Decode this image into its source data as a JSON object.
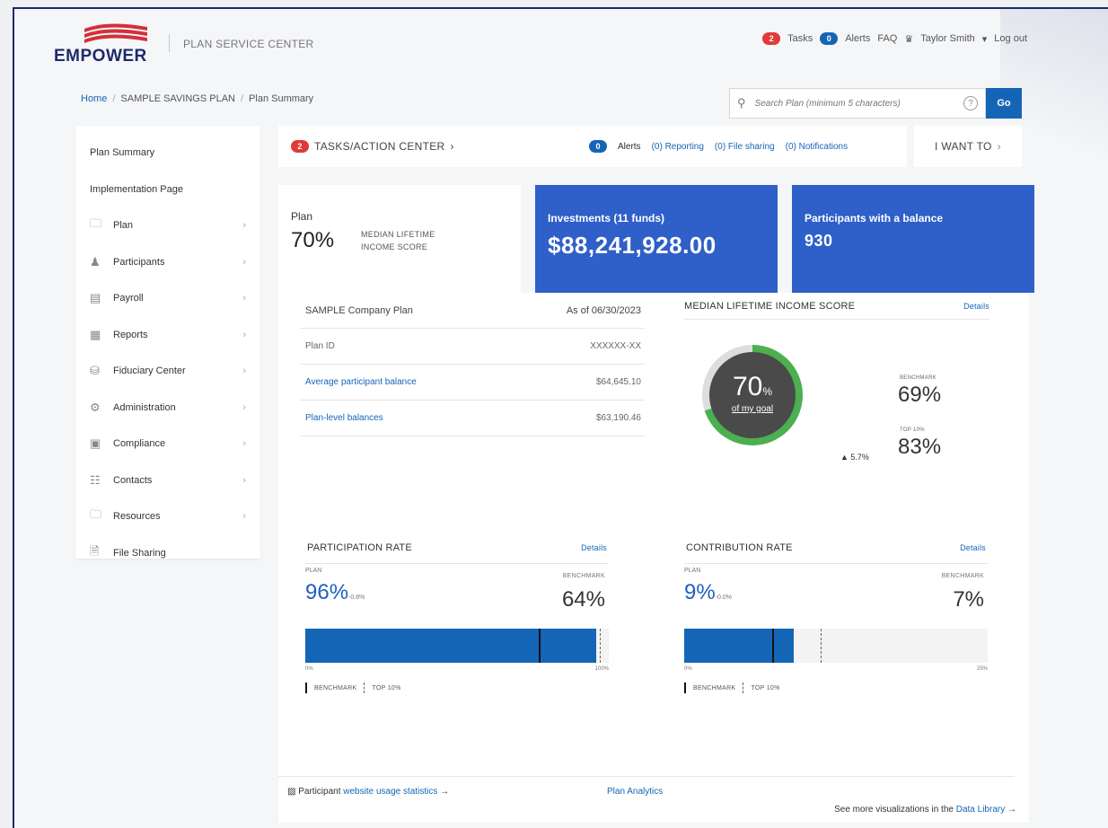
{
  "header": {
    "brand": "EMPOWER",
    "service_title": "PLAN SERVICE CENTER",
    "tasks_count": "2",
    "tasks_label": "Tasks",
    "alerts_count": "0",
    "alerts_label": "Alerts",
    "faq_label": "FAQ",
    "user_name": "Taylor Smith",
    "logout_label": "Log out"
  },
  "breadcrumb": {
    "home": "Home",
    "plan": "SAMPLE SAVINGS PLAN",
    "current": "Plan Summary"
  },
  "search": {
    "placeholder": "Search Plan (minimum 5 characters)",
    "go_label": "Go"
  },
  "sidebar": {
    "items": [
      {
        "label": "Plan Summary"
      },
      {
        "label": "Implementation Page"
      },
      {
        "label": "Plan",
        "icon": "folder-icon"
      },
      {
        "label": "Participants",
        "icon": "people-icon"
      },
      {
        "label": "Payroll",
        "icon": "payroll-icon"
      },
      {
        "label": "Reports",
        "icon": "report-icon"
      },
      {
        "label": "Fiduciary Center",
        "icon": "database-icon"
      },
      {
        "label": "Administration",
        "icon": "gear-icon"
      },
      {
        "label": "Compliance",
        "icon": "compliance-icon"
      },
      {
        "label": "Contacts",
        "icon": "contacts-icon"
      },
      {
        "label": "Resources",
        "icon": "folder-icon"
      },
      {
        "label": "File Sharing",
        "icon": "file-icon"
      }
    ]
  },
  "taskbar": {
    "tasks_count": "2",
    "title": "TASKS/ACTION CENTER",
    "alerts_count": "0",
    "alerts_label": "Alerts",
    "reporting": "(0) Reporting",
    "file_sharing": "(0) File sharing",
    "notifications": "(0) Notifications",
    "i_want_to": "I WANT TO"
  },
  "kpi": {
    "plan_label": "Plan",
    "plan_value": "70%",
    "plan_sub1": "MEDIAN LIFETIME",
    "plan_sub2": "INCOME SCORE",
    "investments_label": "Investments (11 funds)",
    "investments_value": "$88,241,928.00",
    "participants_label": "Participants with a balance",
    "participants_value": "930"
  },
  "plan_info": {
    "name": "SAMPLE Company Plan",
    "as_of": "As of 06/30/2023",
    "rows": [
      {
        "label": "Plan ID",
        "value": "XXXXXX-XX"
      },
      {
        "label": "Average participant balance",
        "value": "$64,645.10"
      },
      {
        "label": "Plan-level balances",
        "value": "$63,190.46"
      }
    ]
  },
  "mlis": {
    "title": "MEDIAN LIFETIME INCOME SCORE",
    "details": "Details",
    "score": "70",
    "score_unit": "%",
    "goal_text": "of my goal",
    "delta": "▲ 5.7%",
    "benchmark_label": "BENCHMARK",
    "benchmark_value": "69%",
    "top10_label": "TOP 10%",
    "top10_value": "83%",
    "score_fraction": 0.7
  },
  "participation": {
    "title": "PARTICIPATION RATE",
    "details": "Details",
    "plan_label": "PLAN",
    "plan_value": "96%",
    "plan_change": "-0.8%",
    "benchmark_label": "BENCHMARK",
    "benchmark_value": "64%",
    "axis_min": "0%",
    "axis_max": "100%",
    "legend_benchmark": "BENCHMARK",
    "legend_top10": "TOP 10%",
    "plan_fraction": 0.96,
    "benchmark_fraction": 0.77,
    "top10_fraction": 0.97
  },
  "contribution": {
    "title": "CONTRIBUTION RATE",
    "details": "Details",
    "plan_label": "PLAN",
    "plan_value": "9%",
    "plan_change": "-0.0%",
    "benchmark_label": "BENCHMARK",
    "benchmark_value": "7%",
    "axis_min": "0%",
    "axis_max": "25%",
    "legend_benchmark": "BENCHMARK",
    "legend_top10": "TOP 10%",
    "plan_fraction": 0.36,
    "benchmark_fraction": 0.29,
    "top10_fraction": 0.45
  },
  "footer": {
    "participant_prefix": "Participant",
    "usage_link": "website usage statistics",
    "plan_analytics": "Plan Analytics",
    "see_more": "See more visualizations in the",
    "data_library": "Data Library"
  },
  "colors": {
    "brand_navy": "#1f2a6b",
    "accent_blue": "#1565b7",
    "kpi_blue": "#2f5fc8",
    "alert_red": "#e03a3a",
    "gauge_green": "#4caf50"
  }
}
